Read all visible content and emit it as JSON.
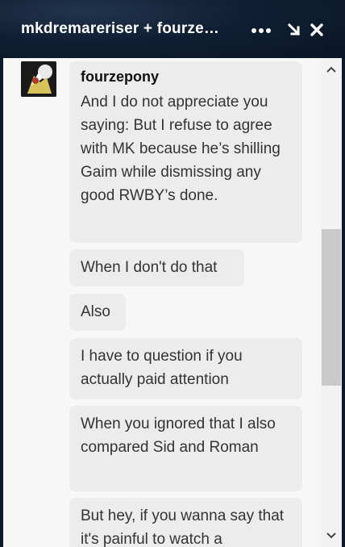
{
  "header": {
    "title": "mkdremareriser + fourze…"
  },
  "icons": {
    "more": "more-horizontal-icon",
    "minimize": "minimize-arrow-icon",
    "close": "close-icon",
    "scroll_up": "chevron-up-icon",
    "scroll_down": "chevron-down-icon"
  },
  "colors": {
    "header_bg": "#0f1f33",
    "panel_bg": "#f7f7f7",
    "bubble_bg": "#ececec",
    "scroll_thumb": "#c9c9c9"
  },
  "messages": {
    "sender": "fourzepony",
    "items": [
      "And I do not appreciate you saying: But I refuse to agree with MK because he’s shilling Gaim while dismissing any good RWBY’s done.",
      "When I don't do that",
      "Also",
      "I have to question if you actually paid attention",
      "When you ignored that I also compared Sid and Roman",
      "But hey, if you wanna say that it's painful to watch a"
    ]
  }
}
